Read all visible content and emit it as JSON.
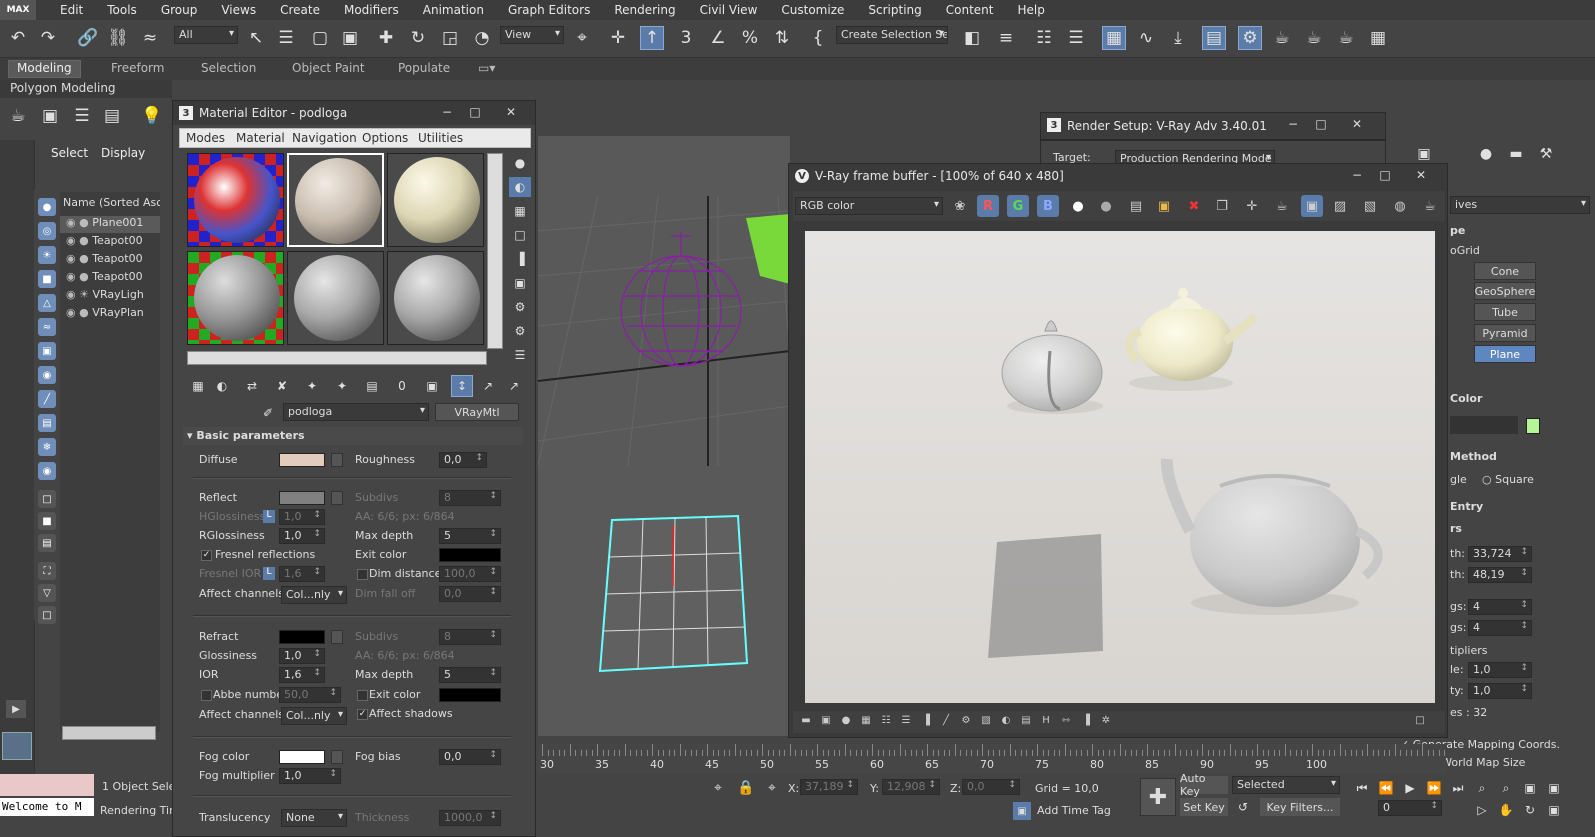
{
  "app": {
    "logo": "MAX"
  },
  "menu": [
    "Edit",
    "Tools",
    "Group",
    "Views",
    "Create",
    "Modifiers",
    "Animation",
    "Graph Editors",
    "Rendering",
    "Civil View",
    "Customize",
    "Scripting",
    "Content",
    "Help"
  ],
  "toolbar": {
    "filter_value": "All",
    "refcoord_value": "View",
    "selection_set_placeholder": "Create Selection Se",
    "undo_icon": "undo-icon",
    "redo_icon": "redo-icon"
  },
  "ribbon": {
    "tabs": [
      "Modeling",
      "Freeform",
      "Selection",
      "Object Paint",
      "Populate"
    ],
    "subtitle": "Polygon Modeling"
  },
  "scene_explorer": {
    "tabs": [
      "Select",
      "Display"
    ],
    "header": "Name (Sorted Ascer",
    "items": [
      "Plane001",
      "Teapot00",
      "Teapot00",
      "Teapot00",
      "VRayLigh",
      "VRayPlan"
    ]
  },
  "material_editor": {
    "title": "Material Editor - podloga",
    "menu": [
      "Modes",
      "Material",
      "Navigation",
      "Options",
      "Utilities"
    ],
    "material_name": "podloga",
    "material_type": "VRayMtl",
    "rollout_title": "Basic parameters",
    "diffuse": {
      "label": "Diffuse",
      "color": "#e3cbbd"
    },
    "roughness": {
      "label": "Roughness",
      "value": "0,0"
    },
    "reflect": {
      "label": "Reflect",
      "color": "#808080"
    },
    "subdivs": {
      "label": "Subdivs",
      "value": "8"
    },
    "hglossiness": {
      "label": "HGlossiness",
      "value": "1,0"
    },
    "aa": "AA: 6/6; px: 6/864",
    "rglossiness": {
      "label": "RGlossiness",
      "value": "1,0"
    },
    "max_depth": {
      "label": "Max depth",
      "value": "5"
    },
    "fresnel": "Fresnel reflections",
    "exit_color": "Exit color",
    "fresnel_ior": {
      "label": "Fresnel IOR",
      "value": "1,6"
    },
    "dim_distance": {
      "label": "Dim distance",
      "value": "100,0"
    },
    "affect_channels": {
      "label": "Affect channels",
      "value": "Col...nly"
    },
    "dim_falloff": {
      "label": "Dim fall off",
      "value": "0,0"
    },
    "refract": {
      "label": "Refract",
      "color": "#000000"
    },
    "r_subdivs": {
      "label": "Subdivs",
      "value": "8"
    },
    "glossiness": {
      "label": "Glossiness",
      "value": "1,0"
    },
    "r_aa": "AA: 6/6; px: 6/864",
    "ior": {
      "label": "IOR",
      "value": "1,6"
    },
    "r_max_depth": {
      "label": "Max depth",
      "value": "5"
    },
    "abbe": {
      "label": "Abbe number",
      "value": "50,0"
    },
    "r_exit_color": "Exit color",
    "r_affect_channels": {
      "label": "Affect channels",
      "value": "Col...nly"
    },
    "affect_shadows": "Affect shadows",
    "fog_color": {
      "label": "Fog color",
      "color": "#ffffff"
    },
    "fog_bias": {
      "label": "Fog bias",
      "value": "0,0"
    },
    "fog_multiplier": {
      "label": "Fog multiplier",
      "value": "1,0"
    },
    "translucency": {
      "label": "Translucency",
      "value": "None"
    },
    "thickness": {
      "label": "Thickness",
      "value": "1000,0"
    }
  },
  "render_setup": {
    "title": "Render Setup: V-Ray Adv 3.40.01",
    "target_label": "Target:",
    "target_value": "Production Rendering Mode"
  },
  "vfb": {
    "title": "V-Ray frame buffer - [100% of 640 x 480]",
    "channel": "RGB color"
  },
  "create_panel": {
    "dropdown": "ives",
    "section_title": "pe",
    "autogrid": "oGrid",
    "buttons": [
      "Cone",
      "GeoSphere",
      "Tube",
      "Pyramid",
      "Plane"
    ],
    "active_button": "Plane",
    "name_color_title": "Color",
    "name_color": "#b5f598",
    "method_title": "Method",
    "method_edge": "gle",
    "method_square": "Square",
    "keyboard_title": "Entry",
    "params_title": "rs",
    "length_label": "th:",
    "length_value": "33,724",
    "width_label": "th:",
    "width_value": "48,19",
    "lsegs_label": "gs:",
    "lsegs_value": "4",
    "wsegs_label": "gs:",
    "wsegs_value": "4",
    "multipliers_title": "tipliers",
    "scale_label": "le:",
    "scale_value": "1,0",
    "density_label": "ty:",
    "density_value": "1,0",
    "total_faces": "es : 32",
    "gen_mapping": "Generate Mapping Coords.",
    "real_world": "Real-World Map Size"
  },
  "timeline": {
    "ticks": [
      "30",
      "35",
      "40",
      "45",
      "50",
      "55",
      "60",
      "65",
      "70",
      "75",
      "80",
      "85",
      "90",
      "95",
      "100"
    ]
  },
  "status": {
    "maxscript": "Welcome to M",
    "selected_count": "1 Object Selec",
    "render_time": "Rendering Time",
    "x_label": "X:",
    "x_value": "37,189",
    "y_label": "Y:",
    "y_value": "12,908",
    "z_label": "Z:",
    "z_value": "0,0",
    "grid": "Grid = 10,0",
    "add_time_tag": "Add Time Tag",
    "auto_key": "Auto Key",
    "set_key": "Set Key",
    "selected_dd": "Selected",
    "key_filters": "Key Filters...",
    "frame": "0"
  }
}
